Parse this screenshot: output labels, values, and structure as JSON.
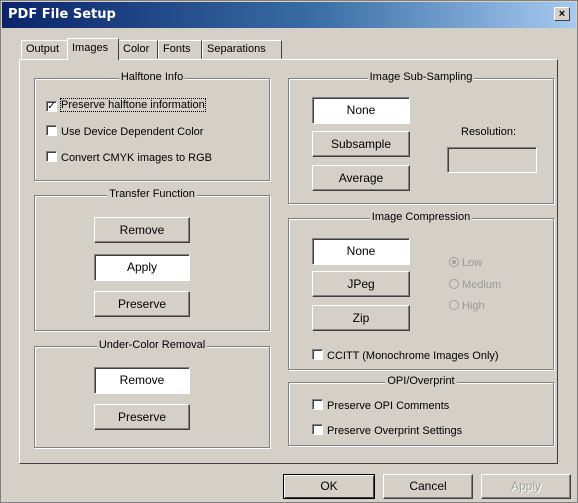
{
  "window": {
    "title": "PDF File Setup",
    "close_glyph": "×"
  },
  "tabs": [
    {
      "label": "Output"
    },
    {
      "label": "Images"
    },
    {
      "label": "Color"
    },
    {
      "label": "Fonts"
    },
    {
      "label": "Separations"
    }
  ],
  "active_tab": "Images",
  "halftone": {
    "legend": "Halftone Info",
    "options": [
      {
        "label": "Preserve halftone information",
        "checked": true
      },
      {
        "label": "Use Device Dependent Color",
        "checked": false
      },
      {
        "label": "Convert CMYK images to RGB",
        "checked": false
      }
    ]
  },
  "transfer": {
    "legend": "Transfer Function",
    "buttons": [
      {
        "label": "Remove",
        "selected": false
      },
      {
        "label": "Apply",
        "selected": true
      },
      {
        "label": "Preserve",
        "selected": false
      }
    ]
  },
  "ucr": {
    "legend": "Under-Color Removal",
    "buttons": [
      {
        "label": "Remove",
        "selected": true
      },
      {
        "label": "Preserve",
        "selected": false
      }
    ]
  },
  "subsampling": {
    "legend": "Image Sub-Sampling",
    "buttons": [
      {
        "label": "None",
        "selected": true
      },
      {
        "label": "Subsample",
        "selected": false
      },
      {
        "label": "Average",
        "selected": false
      }
    ],
    "resolution_label": "Resolution:",
    "resolution_value": ""
  },
  "compression": {
    "legend": "Image Compression",
    "buttons": [
      {
        "label": "None",
        "selected": true
      },
      {
        "label": "JPeg",
        "selected": false
      },
      {
        "label": "Zip",
        "selected": false
      }
    ],
    "quality": [
      {
        "label": "Low",
        "selected": true
      },
      {
        "label": "Medium",
        "selected": false
      },
      {
        "label": "High",
        "selected": false
      }
    ],
    "ccitt_label": "CCITT (Monochrome Images Only)",
    "ccitt_checked": false
  },
  "opi": {
    "legend": "OPI/Overprint",
    "options": [
      {
        "label": "Preserve OPI Comments",
        "checked": false
      },
      {
        "label": "Preserve Overprint Settings",
        "checked": false
      }
    ]
  },
  "footer": {
    "ok": "OK",
    "cancel": "Cancel",
    "apply": "Apply"
  },
  "colors": {
    "face": "#d4d0c8",
    "title_start": "#0a246a",
    "title_end": "#a6caf0"
  }
}
